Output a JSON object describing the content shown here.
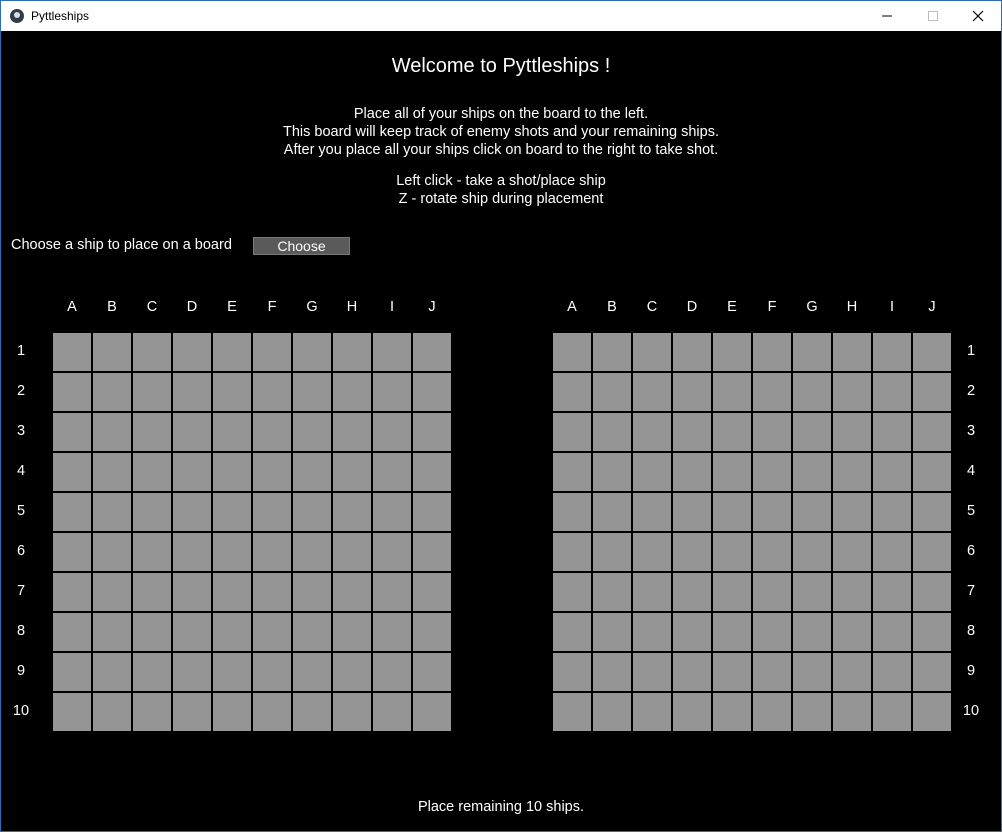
{
  "window": {
    "title": "Pyttleships",
    "app_icon": "kivy-logo-icon",
    "controls": [
      "minimize-icon",
      "maximize-icon",
      "close-icon"
    ]
  },
  "header": {
    "title": "Welcome to Pyttleships !",
    "instructions": [
      "Place all of your ships on the board to the left.",
      "This board will keep track of enemy shots and your remaining ships.",
      "After you place all your ships click on board to the right to take shot."
    ],
    "controls": [
      "Left click - take a shot/place ship",
      "Z - rotate ship during placement"
    ]
  },
  "ship_selector": {
    "label": "Choose a ship to place on a board",
    "button_label": "Choose"
  },
  "boards": {
    "columns": [
      "A",
      "B",
      "C",
      "D",
      "E",
      "F",
      "G",
      "H",
      "I",
      "J"
    ],
    "rows": [
      "1",
      "2",
      "3",
      "4",
      "5",
      "6",
      "7",
      "8",
      "9",
      "10"
    ],
    "cell_color": "#959595"
  },
  "status": {
    "message": "Place remaining 10 ships."
  }
}
